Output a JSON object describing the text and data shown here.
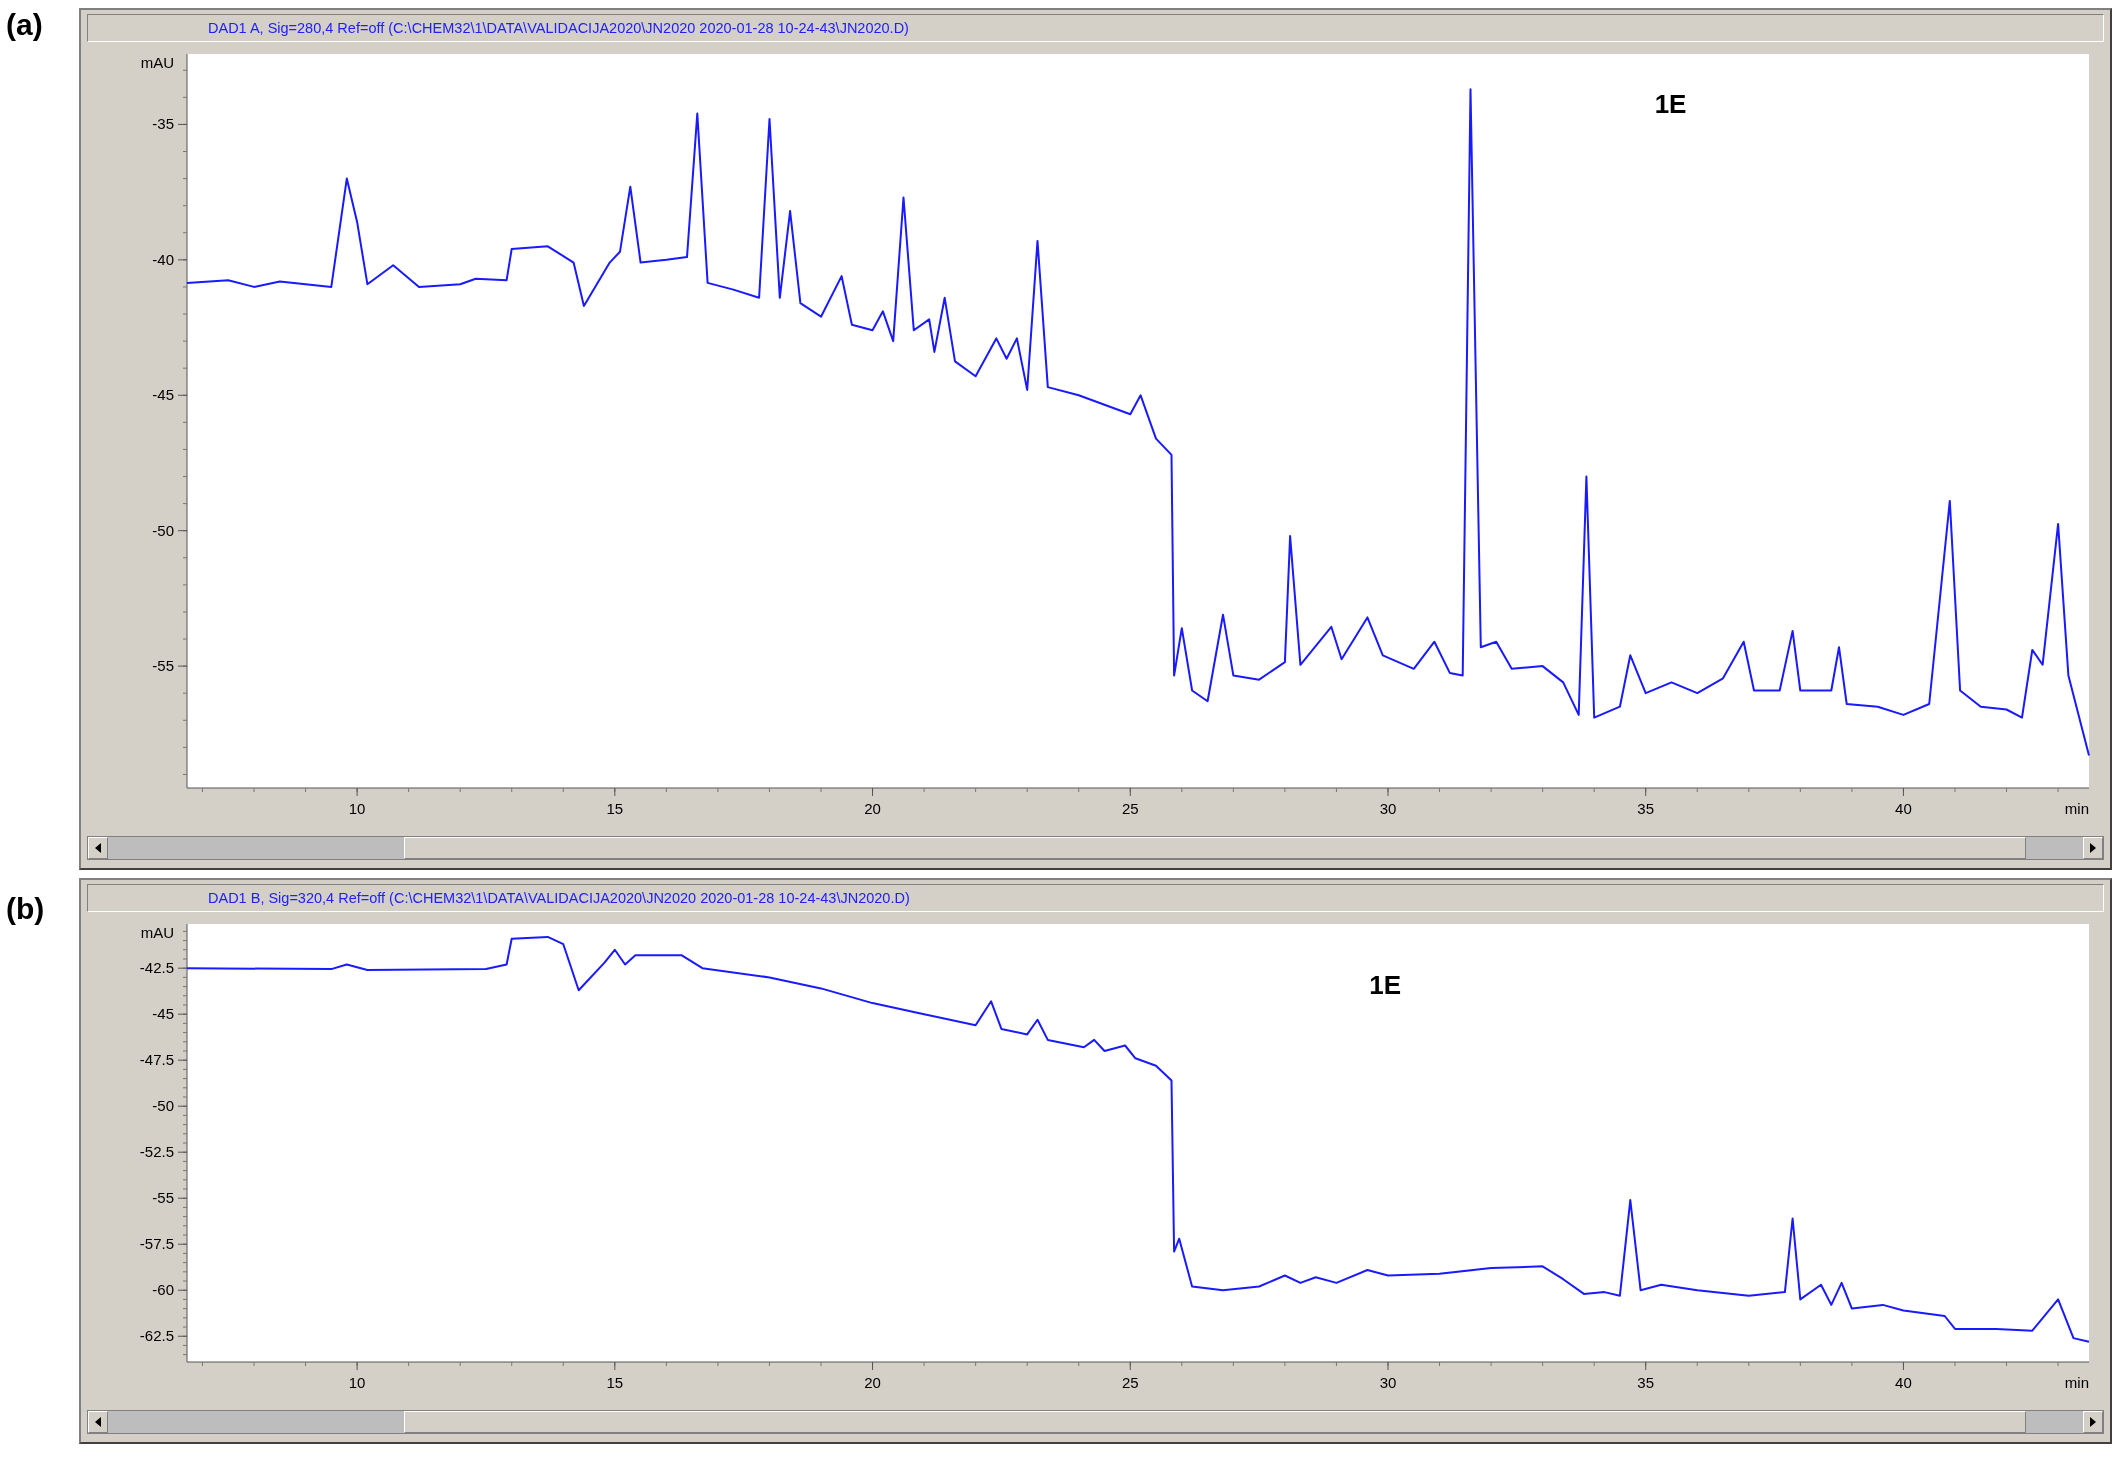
{
  "panels": [
    {
      "figure_label": "(a)",
      "title": "DAD1 A, Sig=280,4 Ref=off (C:\\CHEM32\\1\\DATA\\VALIDACIJA2020\\JN2020 2020-01-28 10-24-43\\JN2020.D)",
      "chart_data": {
        "type": "line",
        "xlabel": "min",
        "ylabel": "mAU",
        "xlim": [
          6.7,
          43.6
        ],
        "ylim": [
          -59.5,
          -32.4
        ],
        "xticks": [
          10,
          15,
          20,
          25,
          30,
          35,
          40
        ],
        "yticks": [
          -35,
          -40,
          -45,
          -50,
          -55
        ],
        "annotations": [
          "1E"
        ],
        "x": [
          6.7,
          7.5,
          8,
          8.5,
          9,
          9.5,
          9.8,
          10,
          10.2,
          10.7,
          11.2,
          12,
          12.3,
          12.9,
          13,
          13.7,
          14.2,
          14.4,
          14.9,
          15.1,
          15.3,
          15.5,
          16,
          16.4,
          16.6,
          16.8,
          17.3,
          17.8,
          18,
          18.2,
          18.4,
          18.6,
          19,
          19.4,
          19.6,
          20,
          20.2,
          20.4,
          20.6,
          20.8,
          21.1,
          21.2,
          21.4,
          21.6,
          22,
          22.4,
          22.6,
          22.8,
          23,
          23.2,
          23.4,
          24,
          25,
          25.2,
          25.5,
          25.8,
          25.85,
          26,
          26.2,
          26.5,
          26.8,
          27,
          27.5,
          28,
          28.1,
          28.3,
          28.9,
          29.1,
          29.6,
          29.9,
          30.5,
          30.9,
          31.2,
          31.45,
          31.6,
          31.8,
          32.1,
          32.4,
          33,
          33.4,
          33.7,
          33.85,
          34,
          34.5,
          34.7,
          35,
          35.5,
          36,
          36.5,
          36.9,
          37.1,
          37.6,
          37.85,
          38,
          38.6,
          38.75,
          38.9,
          39.5,
          40,
          40.5,
          40.9,
          41.1,
          41.5,
          42,
          42.3,
          42.5,
          42.7,
          43,
          43.2,
          43.6
        ],
        "series": [
          {
            "color": "#1a1aff",
            "values": [
              -40.85,
              -40.75,
              -41,
              -40.8,
              -40.9,
              -41,
              -37,
              -38.6,
              -40.9,
              -40.2,
              -41,
              -40.9,
              -40.7,
              -40.75,
              -39.6,
              -39.5,
              -40.1,
              -41.7,
              -40.1,
              -39.7,
              -37.3,
              -40.1,
              -40,
              -39.9,
              -34.6,
              -40.85,
              -41.1,
              -41.4,
              -34.8,
              -41.4,
              -38.2,
              -41.6,
              -42.1,
              -40.6,
              -42.4,
              -42.6,
              -41.9,
              -43,
              -37.7,
              -42.6,
              -42.2,
              -43.4,
              -41.4,
              -43.75,
              -44.3,
              -42.9,
              -43.65,
              -42.9,
              -44.8,
              -39.3,
              -44.7,
              -45,
              -45.7,
              -45,
              -46.6,
              -47.2,
              -55.35,
              -53.6,
              -55.9,
              -56.3,
              -53.1,
              -55.35,
              -55.5,
              -54.85,
              -50.2,
              -54.95,
              -53.55,
              -54.75,
              -53.2,
              -54.6,
              -55.1,
              -54.1,
              -55.25,
              -55.35,
              -33.7,
              -54.3,
              -54.1,
              -55.1,
              -55,
              -55.6,
              -56.8,
              -48,
              -56.9,
              -56.5,
              -54.6,
              -56,
              -55.6,
              -56,
              -55.45,
              -54.1,
              -55.9,
              -55.9,
              -53.7,
              -55.9,
              -55.9,
              -54.3,
              -56.4,
              -56.5,
              -56.8,
              -56.4,
              -48.9,
              -55.9,
              -56.5,
              -56.6,
              -56.9,
              -54.4,
              -54.95,
              -49.75,
              -55.35,
              -58.3
            ]
          }
        ]
      }
    },
    {
      "figure_label": "(b)",
      "title": "DAD1 B, Sig=320,4 Ref=off (C:\\CHEM32\\1\\DATA\\VALIDACIJA2020\\JN2020 2020-01-28 10-24-43\\JN2020.D)",
      "chart_data": {
        "type": "line",
        "xlabel": "min",
        "ylabel": "mAU",
        "xlim": [
          6.7,
          43.6
        ],
        "ylim": [
          -63.9,
          -40.1
        ],
        "xticks": [
          10,
          15,
          20,
          25,
          30,
          35,
          40
        ],
        "yticks": [
          -42.5,
          -45,
          -47.5,
          -50,
          -52.5,
          -55,
          -57.5,
          -60,
          -62.5
        ],
        "annotations": [
          "1E"
        ],
        "x": [
          6.7,
          9.5,
          9.8,
          10.2,
          12.5,
          12.9,
          13,
          13.7,
          14,
          14.3,
          14.8,
          15,
          15.2,
          15.4,
          16.3,
          16.7,
          18,
          19,
          20,
          21,
          22,
          22.3,
          22.5,
          23,
          23.2,
          23.4,
          24.1,
          24.3,
          24.5,
          24.9,
          25.1,
          25.5,
          25.8,
          25.85,
          25.95,
          26.2,
          26.8,
          27.5,
          28,
          28.3,
          28.6,
          29,
          29.6,
          30,
          31,
          32,
          33,
          33.4,
          33.8,
          34.2,
          34.5,
          34.7,
          34.9,
          35.3,
          36,
          37,
          37.7,
          37.85,
          38,
          38.4,
          38.6,
          38.8,
          39,
          39.6,
          40,
          40.8,
          41,
          41.8,
          42.5,
          43,
          43.3,
          43.6
        ],
        "series": [
          {
            "color": "#1a1aff",
            "values": [
              -42.5,
              -42.55,
              -42.3,
              -42.6,
              -42.55,
              -42.3,
              -40.9,
              -40.8,
              -41.2,
              -43.7,
              -42.2,
              -41.5,
              -42.3,
              -41.8,
              -41.8,
              -42.5,
              -43,
              -43.6,
              -44.4,
              -45,
              -45.6,
              -44.3,
              -45.8,
              -46.1,
              -45.3,
              -46.4,
              -46.8,
              -46.4,
              -47,
              -46.7,
              -47.4,
              -47.8,
              -48.6,
              -57.9,
              -57.2,
              -59.8,
              -60,
              -59.8,
              -59.2,
              -59.6,
              -59.3,
              -59.6,
              -58.9,
              -59.2,
              -59.1,
              -58.8,
              -58.7,
              -59.4,
              -60.2,
              -60.1,
              -60.3,
              -55.1,
              -60,
              -59.7,
              -60,
              -60.3,
              -60.1,
              -56.1,
              -60.5,
              -59.7,
              -60.8,
              -59.6,
              -61,
              -60.8,
              -61.1,
              -61.4,
              -62.1,
              -62.1,
              -62.2,
              -60.5,
              -62.6,
              -62.8
            ]
          }
        ]
      }
    }
  ]
}
